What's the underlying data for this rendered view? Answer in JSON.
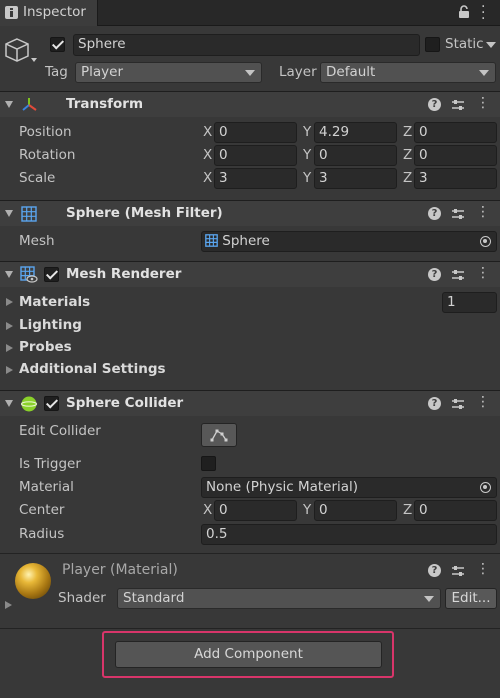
{
  "tab": {
    "title": "Inspector"
  },
  "gameobject": {
    "name": "Sphere",
    "static_label": "Static",
    "tag_label": "Tag",
    "tag_value": "Player",
    "layer_label": "Layer",
    "layer_value": "Default"
  },
  "transform": {
    "title": "Transform",
    "position_label": "Position",
    "position": {
      "x": "0",
      "y": "4.29",
      "z": "0"
    },
    "rotation_label": "Rotation",
    "rotation": {
      "x": "0",
      "y": "0",
      "z": "0"
    },
    "scale_label": "Scale",
    "scale": {
      "x": "3",
      "y": "3",
      "z": "3"
    }
  },
  "axes": {
    "x": "X",
    "y": "Y",
    "z": "Z"
  },
  "mesh_filter": {
    "title": "Sphere (Mesh Filter)",
    "mesh_label": "Mesh",
    "mesh_value": "Sphere"
  },
  "mesh_renderer": {
    "title": "Mesh Renderer",
    "materials_label": "Materials",
    "materials_count": "1",
    "lighting_label": "Lighting",
    "probes_label": "Probes",
    "additional_label": "Additional Settings"
  },
  "sphere_collider": {
    "title": "Sphere Collider",
    "edit_label": "Edit Collider",
    "trigger_label": "Is Trigger",
    "material_label": "Material",
    "material_value": "None (Physic Material)",
    "center_label": "Center",
    "center": {
      "x": "0",
      "y": "0",
      "z": "0"
    },
    "radius_label": "Radius",
    "radius_value": "0.5"
  },
  "material": {
    "title": "Player (Material)",
    "shader_label": "Shader",
    "shader_value": "Standard",
    "edit_button": "Edit..."
  },
  "add_component": {
    "label": "Add Component"
  },
  "colors": {
    "highlight": "#d8356a",
    "background": "#383838"
  }
}
